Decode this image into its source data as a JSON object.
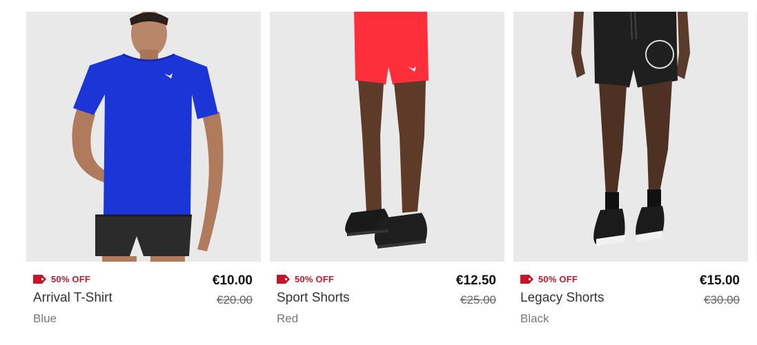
{
  "products": [
    {
      "badge": "50% OFF",
      "name": "Arrival T-Shirt",
      "color": "Blue",
      "price": "€10.00",
      "old_price": "€20.00",
      "icon": "tag-icon",
      "badge_color": "#c4162a"
    },
    {
      "badge": "50% OFF",
      "name": "Sport Shorts",
      "color": "Red",
      "price": "€12.50",
      "old_price": "€25.00",
      "icon": "tag-icon",
      "badge_color": "#c4162a"
    },
    {
      "badge": "50% OFF",
      "name": "Legacy Shorts",
      "color": "Black",
      "price": "€15.00",
      "old_price": "€30.00",
      "icon": "tag-icon",
      "badge_color": "#c4162a"
    }
  ],
  "image_background": "#e9e9e9"
}
